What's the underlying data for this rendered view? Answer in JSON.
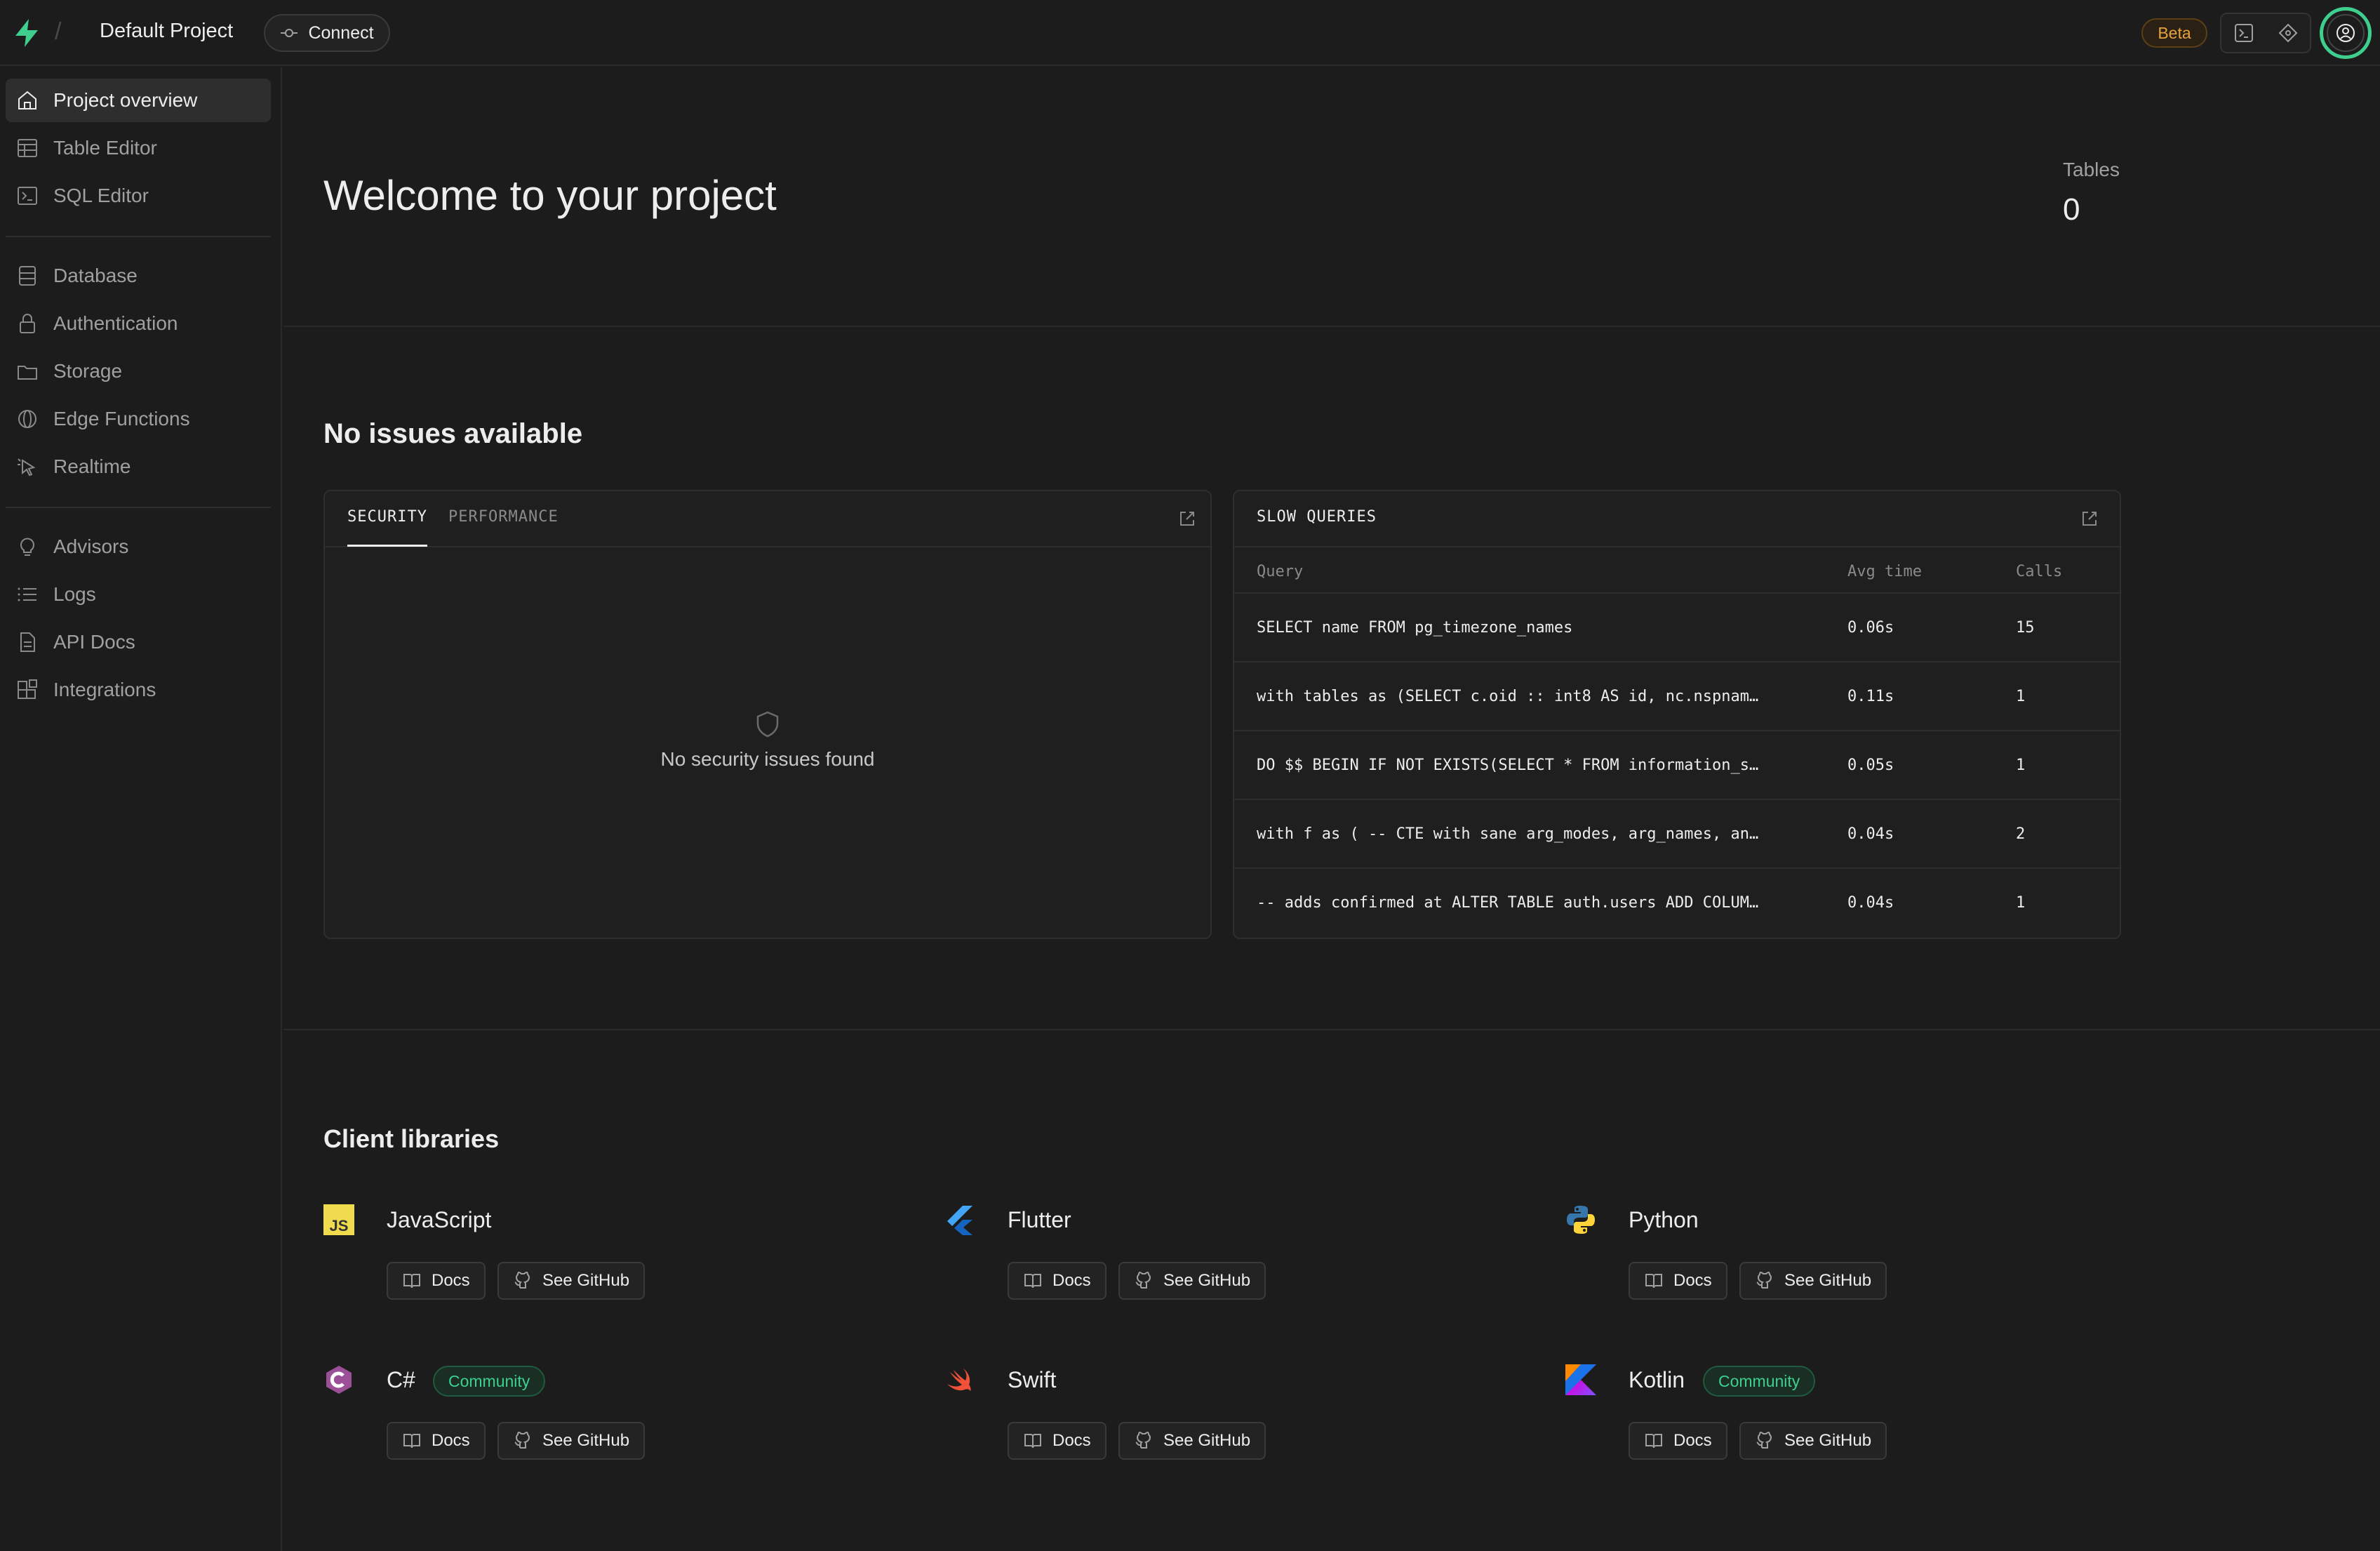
{
  "topbar": {
    "project_name": "Default Project",
    "connect_label": "Connect",
    "beta_label": "Beta"
  },
  "sidebar": {
    "items": [
      {
        "label": "Project overview",
        "icon": "home-icon"
      },
      {
        "label": "Table Editor",
        "icon": "table-icon"
      },
      {
        "label": "SQL Editor",
        "icon": "terminal-icon"
      },
      {
        "label": "Database",
        "icon": "database-icon"
      },
      {
        "label": "Authentication",
        "icon": "lock-icon"
      },
      {
        "label": "Storage",
        "icon": "archive-icon"
      },
      {
        "label": "Edge Functions",
        "icon": "globe-icon"
      },
      {
        "label": "Realtime",
        "icon": "pointer-icon"
      },
      {
        "label": "Advisors",
        "icon": "lightbulb-icon"
      },
      {
        "label": "Logs",
        "icon": "list-icon"
      },
      {
        "label": "API Docs",
        "icon": "file-icon"
      },
      {
        "label": "Integrations",
        "icon": "blocks-icon"
      }
    ]
  },
  "hero": {
    "title": "Welcome to your project",
    "tables_label": "Tables",
    "tables_value": "0"
  },
  "issues": {
    "title": "No issues available",
    "tabs": [
      "SECURITY",
      "PERFORMANCE"
    ],
    "empty_text": "No security issues found"
  },
  "slow_queries": {
    "title": "SLOW QUERIES",
    "columns": [
      "Query",
      "Avg time",
      "Calls"
    ],
    "rows": [
      {
        "query": "SELECT name FROM pg_timezone_names",
        "avg": "0.06s",
        "calls": "15"
      },
      {
        "query": "with tables as (SELECT c.oid :: int8 AS id, nc.nspnam…",
        "avg": "0.11s",
        "calls": "1"
      },
      {
        "query": "DO $$ BEGIN IF NOT EXISTS(SELECT * FROM information_s…",
        "avg": "0.05s",
        "calls": "1"
      },
      {
        "query": "with f as ( -- CTE with sane arg_modes, arg_names, an…",
        "avg": "0.04s",
        "calls": "2"
      },
      {
        "query": "-- adds confirmed at ALTER TABLE auth.users ADD COLUM…",
        "avg": "0.04s",
        "calls": "1"
      }
    ]
  },
  "client_libraries": {
    "title": "Client libraries",
    "docs_label": "Docs",
    "github_label": "See GitHub",
    "community_label": "Community",
    "libs": [
      {
        "name": "JavaScript",
        "icon": "javascript-icon"
      },
      {
        "name": "Flutter",
        "icon": "flutter-icon"
      },
      {
        "name": "Python",
        "icon": "python-icon"
      },
      {
        "name": "C#",
        "icon": "csharp-icon",
        "community": true
      },
      {
        "name": "Swift",
        "icon": "swift-icon"
      },
      {
        "name": "Kotlin",
        "icon": "kotlin-icon",
        "community": true
      }
    ]
  },
  "colors": {
    "background": "#1c1c1c",
    "brand_green": "#3ecf8e",
    "beta_orange": "#e9a23b"
  }
}
